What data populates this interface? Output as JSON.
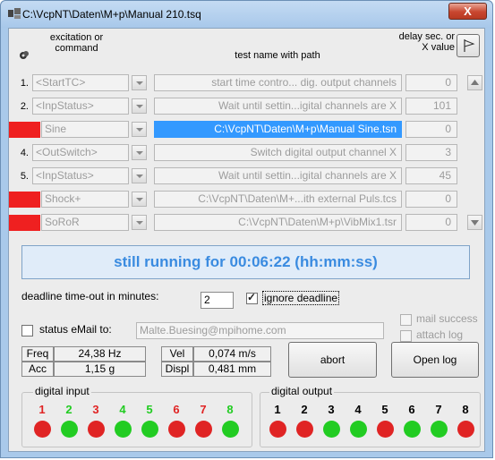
{
  "window": {
    "title": "C:\\VcpNT\\Daten\\M+p\\Manual 210.tsq",
    "close_label": "X"
  },
  "headers": {
    "excitation": "excitation or command",
    "test_name": "test name with path",
    "delay": "delay sec. or X value"
  },
  "rows": [
    {
      "num": "1.",
      "command": "<StartTC>",
      "path": "start time contro... dig. output channels",
      "value": "0",
      "marked": false,
      "selected": false
    },
    {
      "num": "2.",
      "command": "<InpStatus>",
      "path": "Wait until settin...igital channels are X",
      "value": "101",
      "marked": false,
      "selected": false
    },
    {
      "num": "3.",
      "command": "Sine",
      "path": "C:\\VcpNT\\Daten\\M+p\\Manual Sine.tsn",
      "value": "0",
      "marked": true,
      "selected": true
    },
    {
      "num": "4.",
      "command": "<OutSwitch>",
      "path": "Switch digital output channel X",
      "value": "3",
      "marked": false,
      "selected": false
    },
    {
      "num": "5.",
      "command": "<InpStatus>",
      "path": "Wait until settin...igital channels are X",
      "value": "45",
      "marked": false,
      "selected": false
    },
    {
      "num": "6.",
      "command": "Shock+",
      "path": "C:\\VcpNT\\Daten\\M+...ith external Puls.tcs",
      "value": "0",
      "marked": true,
      "selected": false
    },
    {
      "num": "7.",
      "command": "SoRoR",
      "path": "C:\\VcpNT\\Daten\\M+p\\VibMix1.tsr",
      "value": "0",
      "marked": true,
      "selected": false
    }
  ],
  "status_banner": "still running for 00:06:22 (hh:mm:ss)",
  "deadline": {
    "label": "deadline time-out in minutes:",
    "value": "2",
    "ignore_label": "ignore deadline",
    "ignore_checked": true
  },
  "email": {
    "label": "status eMail to:",
    "placeholder_value": "Malte.Buesing@mpihome.com",
    "checked": false,
    "mail_success_label": "mail success",
    "attach_log_label": "attach log"
  },
  "measurements": {
    "freq_label": "Freq",
    "freq_value": "24,38 Hz",
    "acc_label": "Acc",
    "acc_value": "1,15 g",
    "vel_label": "Vel",
    "vel_value": "0,074 m/s",
    "displ_label": "Displ",
    "displ_value": "0,481 mm"
  },
  "buttons": {
    "abort": "abort",
    "open_log": "Open log"
  },
  "digital_input": {
    "title": "digital input",
    "channels": [
      "1",
      "2",
      "3",
      "4",
      "5",
      "6",
      "7",
      "8"
    ],
    "states": [
      "red",
      "green",
      "red",
      "green",
      "green",
      "red",
      "red",
      "green"
    ]
  },
  "digital_output": {
    "title": "digital output",
    "channels": [
      "1",
      "2",
      "3",
      "4",
      "5",
      "6",
      "7",
      "8"
    ],
    "states": [
      "red",
      "red",
      "green",
      "green",
      "red",
      "green",
      "green",
      "red"
    ]
  },
  "colors": {
    "red_led": "#e02424",
    "green_led": "#22cc22",
    "red_num": "#e02424",
    "green_num": "#22cc22",
    "accent_blue": "#3a8be0",
    "selected_row": "#3399ff",
    "marker_red": "#ef2020"
  },
  "icons": {
    "app": "app-icon",
    "gear": "gear-icon",
    "flag": "flag-icon"
  }
}
